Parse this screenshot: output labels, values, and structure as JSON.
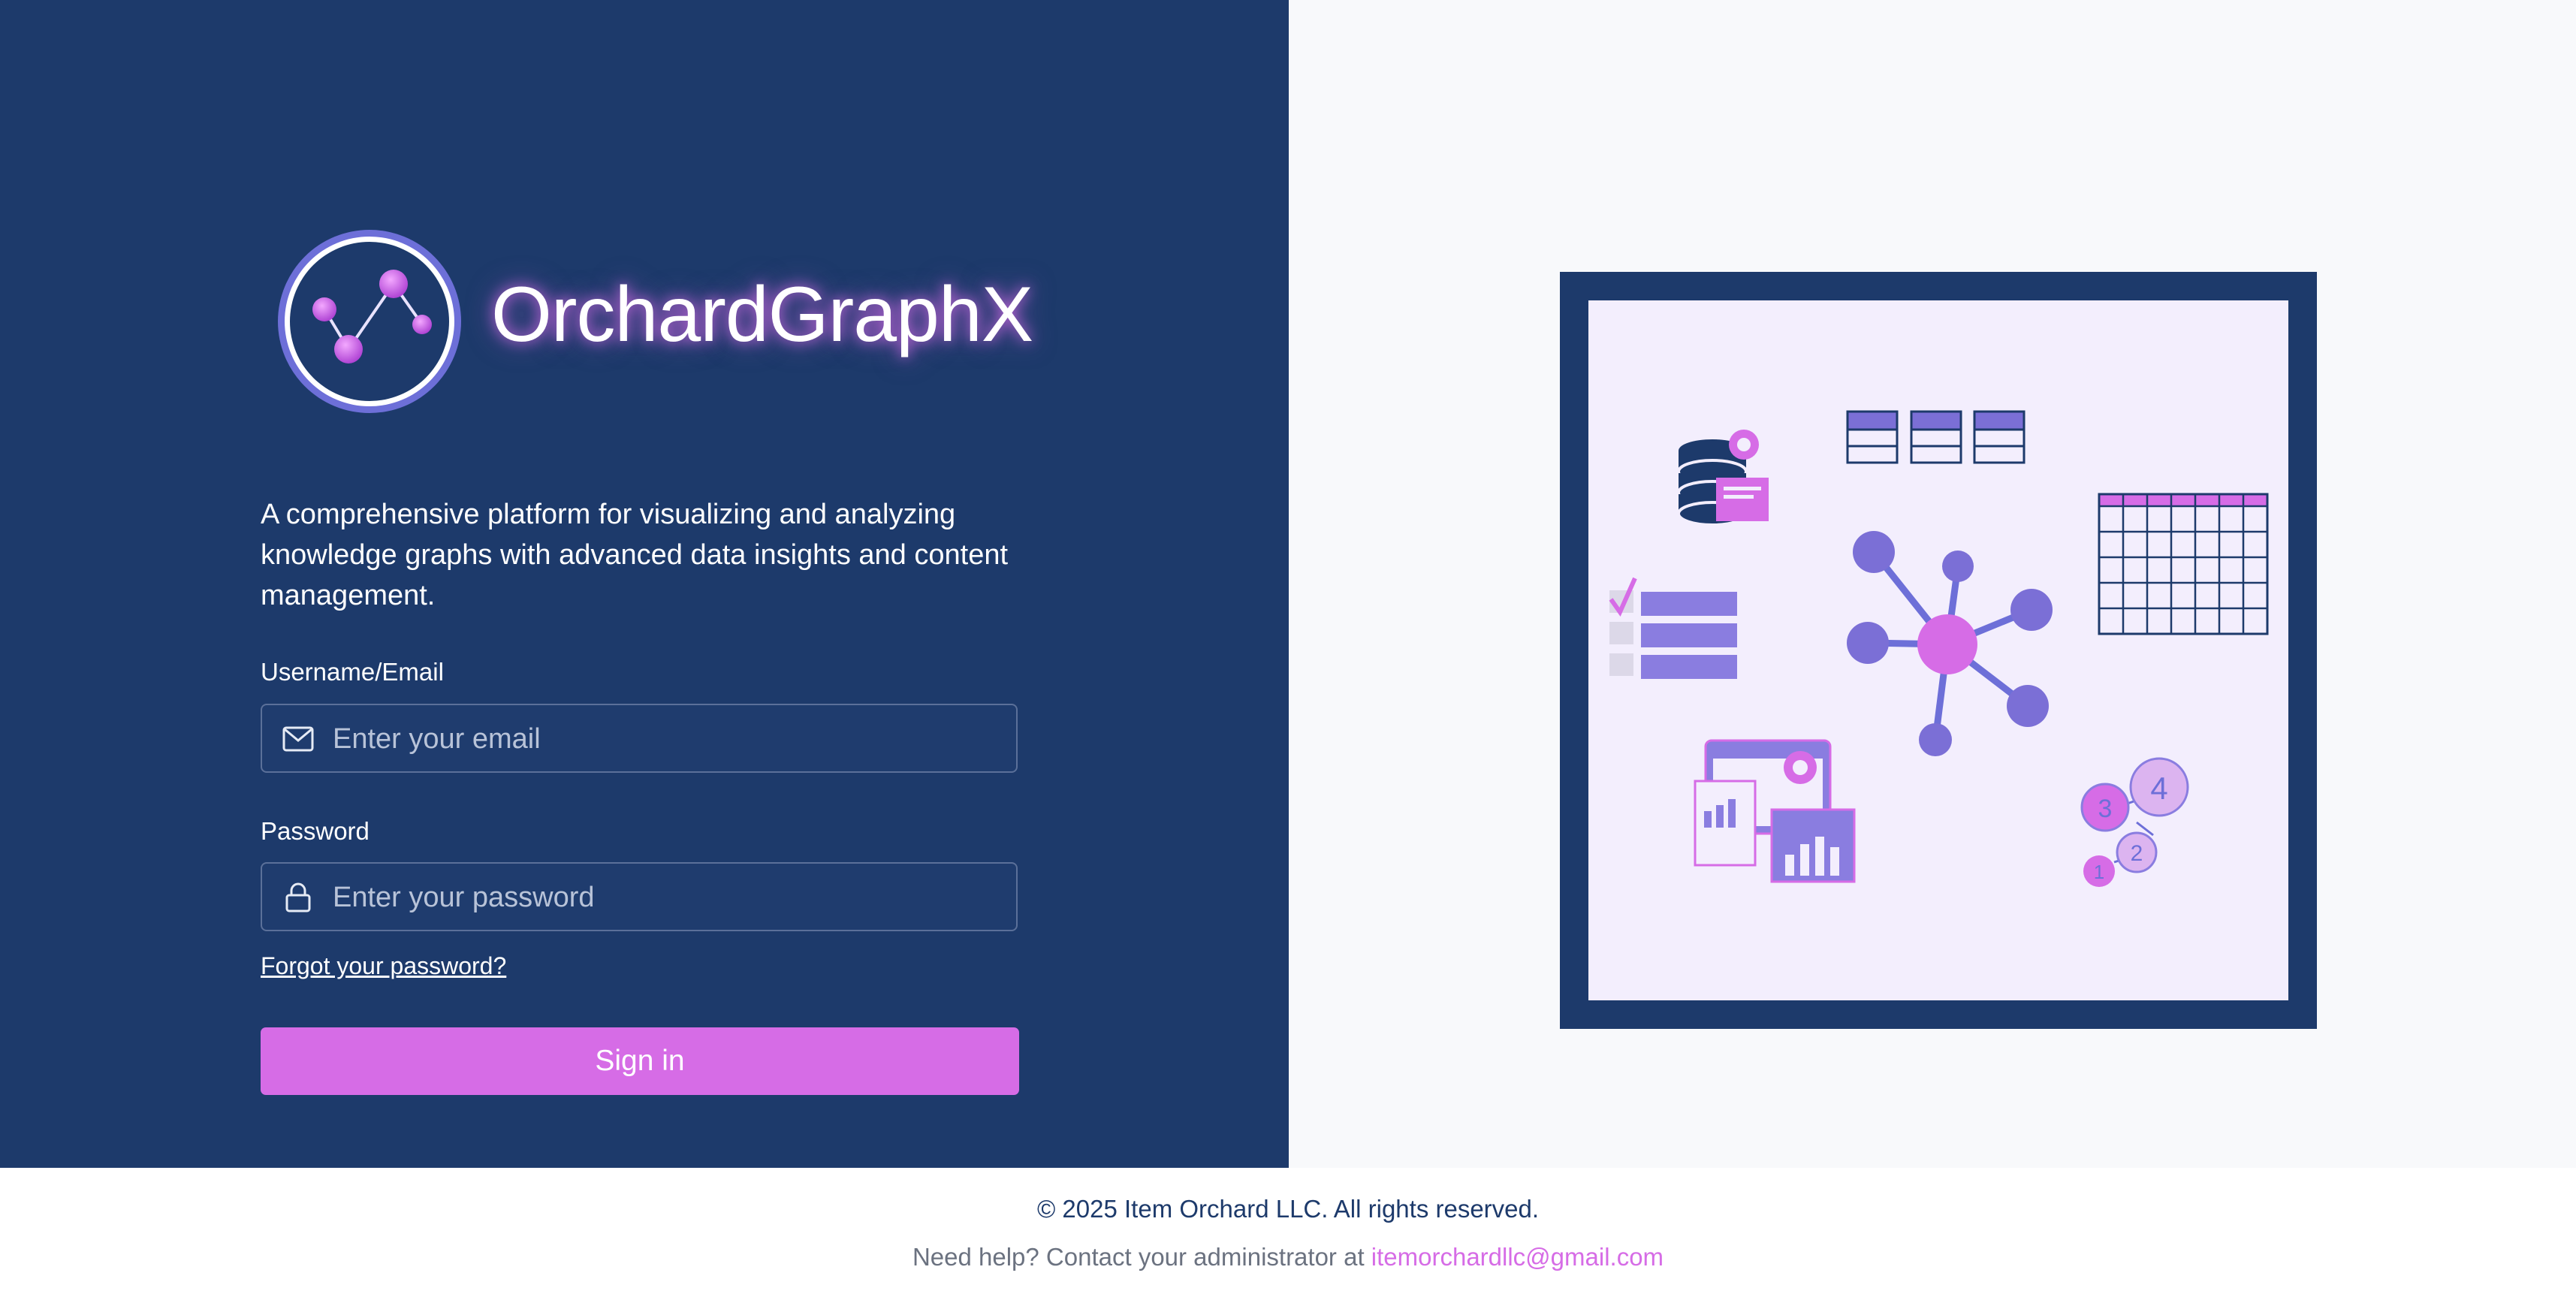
{
  "brand": {
    "name": "OrchardGraphX"
  },
  "tagline": "A comprehensive platform for visualizing and analyzing knowledge graphs with advanced data insights and content management.",
  "form": {
    "username_label": "Username/Email",
    "username_placeholder": "Enter your email",
    "password_label": "Password",
    "password_placeholder": "Enter your password",
    "forgot_label": "Forgot your password?",
    "signin_label": "Sign in"
  },
  "footer": {
    "copyright": "© 2025 Item Orchard LLC. All rights reserved.",
    "help_text": "Need help? Contact your administrator at",
    "help_email": "itemorchardllc@gmail.com"
  },
  "illustration": {
    "step_numbers": [
      "1",
      "2",
      "3",
      "4"
    ]
  },
  "colors": {
    "left_bg": "#1d3a6b",
    "accent": "#d66ce6",
    "secondary": "#7b6fd6",
    "right_bg": "#f8f9fb"
  },
  "icons": {
    "logo": "graph-logo-icon",
    "email": "mail-icon",
    "password": "lock-icon"
  }
}
